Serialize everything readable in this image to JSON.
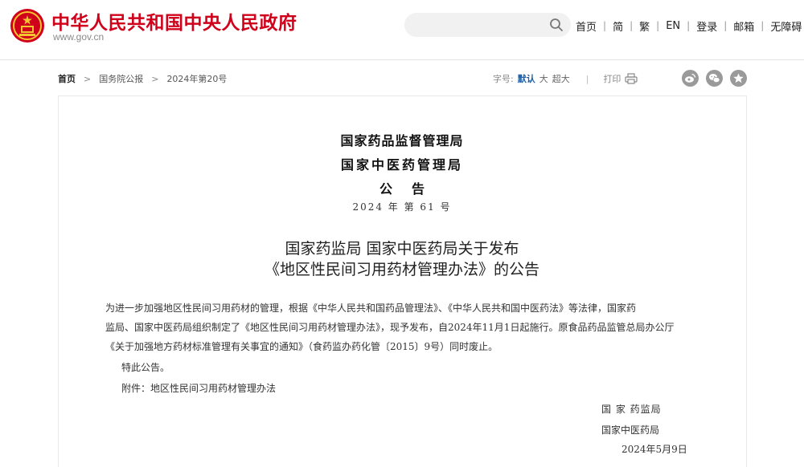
{
  "header": {
    "site_title": "中华人民共和国中央人民政府",
    "site_domain": "www.gov.cn",
    "search_placeholder": "",
    "nav": [
      "首页",
      "简",
      "繁",
      "EN",
      "登录",
      "邮箱",
      "无障碍"
    ],
    "colors": {
      "brand_red": "#d0011b",
      "accent_blue": "#1b5fa8"
    }
  },
  "breadcrumb": {
    "items": [
      "首页",
      "国务院公报",
      "2024年第20号"
    ]
  },
  "toolbar": {
    "font_size_label": "字号:",
    "font_size_options": [
      "默认",
      "大",
      "超大"
    ],
    "font_size_selected": "默认",
    "divider": "|",
    "print_label": "打印",
    "share_icons": [
      "weibo-icon",
      "wechat-icon",
      "favorite-star-icon"
    ]
  },
  "document": {
    "issuers": [
      "国家药品监督管理局",
      "国家中医药管理局",
      "公告"
    ],
    "doc_number": "2024 年 第 61 号",
    "title_lines": [
      "国家药监局 国家中医药局关于发布",
      "《地区性民间习用药材管理办法》的公告"
    ],
    "body_lines": [
      "为进一步加强地区性民间习用药材的管理，根据《中华人民共和国药品管理法》、《中华人民共和国中医药法》等法律，国家药",
      "监局、国家中医药局组织制定了《地区性民间习用药材管理办法》，现予发布，自2024年11月1日起施行。原食品药品监管总局办公厅",
      "《关于加强地方药材标准管理有关事宜的通知》（食药监办药化管〔2015〕9号）同时废止。",
      "特此公告。",
      "附件：地区性民间习用药材管理办法"
    ],
    "signatures": [
      "国 家 药监局",
      "国家中医药局",
      "2024年5月9日"
    ]
  }
}
